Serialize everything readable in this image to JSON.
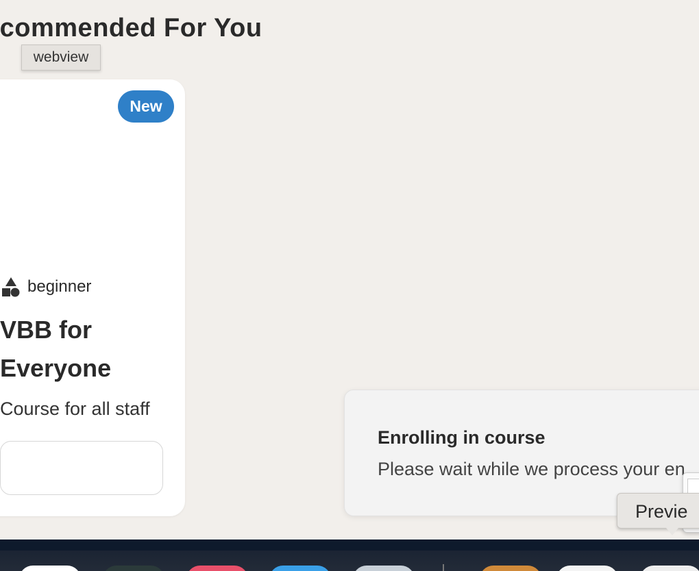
{
  "section": {
    "title": "ecommended For You"
  },
  "tooltip": {
    "webview": "webview",
    "preview": "Previe"
  },
  "card": {
    "badge": "New",
    "level": "beginner",
    "title": "VBB for Everyone",
    "description": "Course for all staff"
  },
  "toast": {
    "title": "Enrolling in course",
    "message": "Please wait while we process your en"
  },
  "colors": {
    "background": "#f2efeb",
    "badge": "#2f80c8",
    "dock": "#0e1a2c"
  },
  "dock": {
    "apps": [
      {
        "name": "finder-app",
        "color": "#ffffff"
      },
      {
        "name": "terminal-app",
        "color": "#2b3a3a"
      },
      {
        "name": "music-app",
        "color": "#e8506a"
      },
      {
        "name": "mail-app",
        "color": "#3aa0e8"
      },
      {
        "name": "system-app",
        "color": "#c8d0d8"
      },
      {
        "name": "avatar-app",
        "color": "#d08a3a"
      },
      {
        "name": "textedit-app",
        "color": "#f4f4f4"
      },
      {
        "name": "preview-app",
        "color": "#eeeeee"
      }
    ]
  }
}
